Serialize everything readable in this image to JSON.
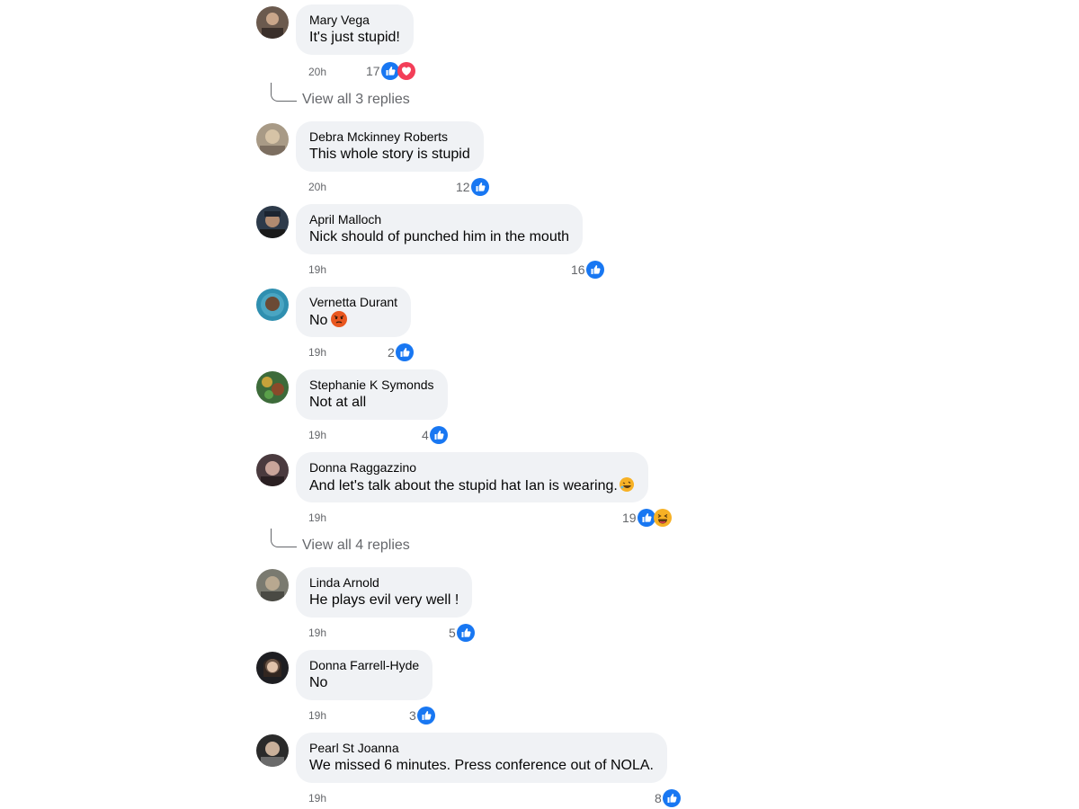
{
  "comments": [
    {
      "author": "Mary Vega",
      "text": "It's just stupid!",
      "time": "20h",
      "count": "17",
      "reactions": [
        "like",
        "love"
      ]
    },
    {
      "author": "Debra Mckinney Roberts",
      "text": "This whole story is stupid",
      "time": "20h",
      "count": "12",
      "reactions": [
        "like"
      ]
    },
    {
      "author": "April Malloch",
      "text": "Nick should of punched him in the mouth",
      "time": "19h",
      "count": "16",
      "reactions": [
        "like"
      ]
    },
    {
      "author": "Vernetta Durant",
      "text": "No",
      "time": "19h",
      "count": "2",
      "reactions": [
        "like"
      ],
      "emoji": "angry"
    },
    {
      "author": "Stephanie K Symonds",
      "text": "Not at all",
      "time": "19h",
      "count": "4",
      "reactions": [
        "like"
      ]
    },
    {
      "author": "Donna Raggazzino",
      "text": "And let's talk about the stupid hat Ian is wearing.",
      "time": "19h",
      "count": "19",
      "reactions": [
        "like",
        "haha"
      ],
      "emoji": "rofl"
    },
    {
      "author": "Linda Arnold",
      "text": "He plays evil very well !",
      "time": "19h",
      "count": "5",
      "reactions": [
        "like"
      ]
    },
    {
      "author": "Donna Farrell-Hyde",
      "text": "No",
      "time": "19h",
      "count": "3",
      "reactions": [
        "like"
      ]
    },
    {
      "author": "Pearl St Joanna",
      "text": "We missed 6 minutes. Press conference out of NOLA.",
      "time": "19h",
      "count": "8",
      "reactions": [
        "like"
      ]
    }
  ],
  "replies": [
    {
      "label": "View all 3 replies"
    },
    {
      "label": "View all 4 replies"
    }
  ],
  "colors": {
    "like": "#1877f2",
    "love": "#f33e58",
    "haha": "#f7b125",
    "bubble": "#f0f2f5",
    "meta": "#65676b"
  }
}
